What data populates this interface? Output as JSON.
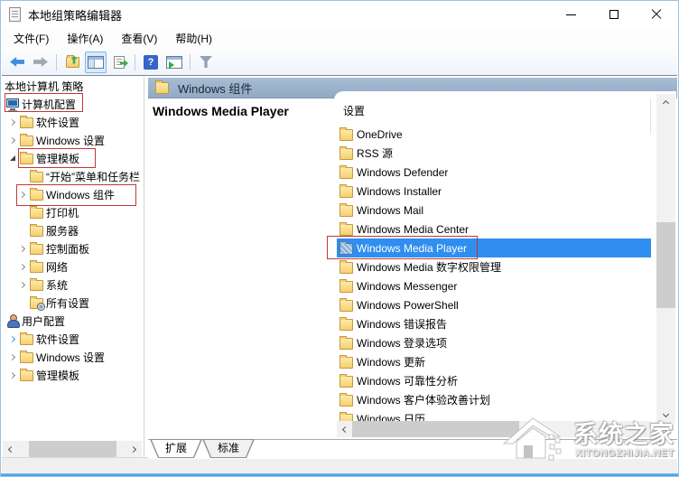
{
  "window": {
    "title": "本地组策略编辑器"
  },
  "window_controls": [
    {
      "icon": "minimize-icon"
    },
    {
      "icon": "maximize-icon"
    },
    {
      "icon": "close-icon"
    }
  ],
  "menu_bar": {
    "items": [
      {
        "label": "文件(F)"
      },
      {
        "label": "操作(A)"
      },
      {
        "label": "查看(V)"
      },
      {
        "label": "帮助(H)"
      }
    ]
  },
  "toolbar": {
    "buttons": [
      {
        "icon": "back-icon"
      },
      {
        "icon": "forward-icon"
      },
      {
        "icon": "separator"
      },
      {
        "icon": "up-one-level-icon"
      },
      {
        "icon": "show-console-tree-icon",
        "pressed": true
      },
      {
        "icon": "export-list-icon"
      },
      {
        "icon": "separator"
      },
      {
        "icon": "help-icon"
      },
      {
        "icon": "show-action-pane-icon"
      },
      {
        "icon": "separator"
      },
      {
        "icon": "filter-icon"
      }
    ]
  },
  "tree": {
    "items": [
      {
        "label": "本地计算机 策略",
        "level": 0,
        "arrow": "none",
        "icon": "none"
      },
      {
        "label": "计算机配置",
        "level": 1,
        "arrow": "none",
        "icon": "computer-icon",
        "annotated": true
      },
      {
        "label": "软件设置",
        "level": 2,
        "arrow": "collapsed",
        "icon": "folder-icon"
      },
      {
        "label": "Windows 设置",
        "level": 2,
        "arrow": "collapsed",
        "icon": "folder-icon"
      },
      {
        "label": "管理模板",
        "level": 2,
        "arrow": "expanded",
        "icon": "folder-icon",
        "annotated": true
      },
      {
        "label": "“开始”菜单和任务栏",
        "level": 3,
        "arrow": "none",
        "icon": "folder-icon"
      },
      {
        "label": "Windows 组件",
        "level": 3,
        "arrow": "collapsed",
        "icon": "folder-icon",
        "annotated": true
      },
      {
        "label": "打印机",
        "level": 3,
        "arrow": "none",
        "icon": "folder-icon"
      },
      {
        "label": "服务器",
        "level": 3,
        "arrow": "none",
        "icon": "folder-icon"
      },
      {
        "label": "控制面板",
        "level": 3,
        "arrow": "collapsed",
        "icon": "folder-icon"
      },
      {
        "label": "网络",
        "level": 3,
        "arrow": "collapsed",
        "icon": "folder-icon"
      },
      {
        "label": "系统",
        "level": 3,
        "arrow": "collapsed",
        "icon": "folder-icon"
      },
      {
        "label": "所有设置",
        "level": 3,
        "arrow": "none",
        "icon": "folder-settings-icon"
      },
      {
        "label": "用户配置",
        "level": 1,
        "arrow": "none",
        "icon": "user-icon"
      },
      {
        "label": "软件设置",
        "level": 2,
        "arrow": "collapsed-blue",
        "icon": "folder-icon"
      },
      {
        "label": "Windows 设置",
        "level": 2,
        "arrow": "collapsed",
        "icon": "folder-icon"
      },
      {
        "label": "管理模板",
        "level": 2,
        "arrow": "collapsed",
        "icon": "folder-icon"
      }
    ]
  },
  "right_pane": {
    "header": {
      "label": "Windows 组件",
      "icon": "folder-icon"
    },
    "extended_title": "Windows Media Player",
    "list": {
      "column_header": "设置",
      "items": [
        {
          "label": "OneDrive"
        },
        {
          "label": "RSS 源"
        },
        {
          "label": "Windows Defender"
        },
        {
          "label": "Windows Installer"
        },
        {
          "label": "Windows Mail"
        },
        {
          "label": "Windows Media Center"
        },
        {
          "label": "Windows Media Player",
          "selected": true
        },
        {
          "label": "Windows Media 数字权限管理"
        },
        {
          "label": "Windows Messenger"
        },
        {
          "label": "Windows PowerShell"
        },
        {
          "label": "Windows 错误报告"
        },
        {
          "label": "Windows 登录选项"
        },
        {
          "label": "Windows 更新"
        },
        {
          "label": "Windows 可靠性分析"
        },
        {
          "label": "Windows 客户体验改善计划"
        },
        {
          "label": "Windows 日历"
        }
      ]
    },
    "tabs": [
      {
        "label": "扩展",
        "active": true
      },
      {
        "label": "标准",
        "active": false
      }
    ]
  },
  "watermark": {
    "brand": "系统之家",
    "domain": "XITONGZHIJIA.NET"
  },
  "colors": {
    "selection": "#2f8ef0",
    "header_band": "#97b1ca",
    "annotation": "#c23737",
    "window_border_bottom": "#3e9be4"
  }
}
